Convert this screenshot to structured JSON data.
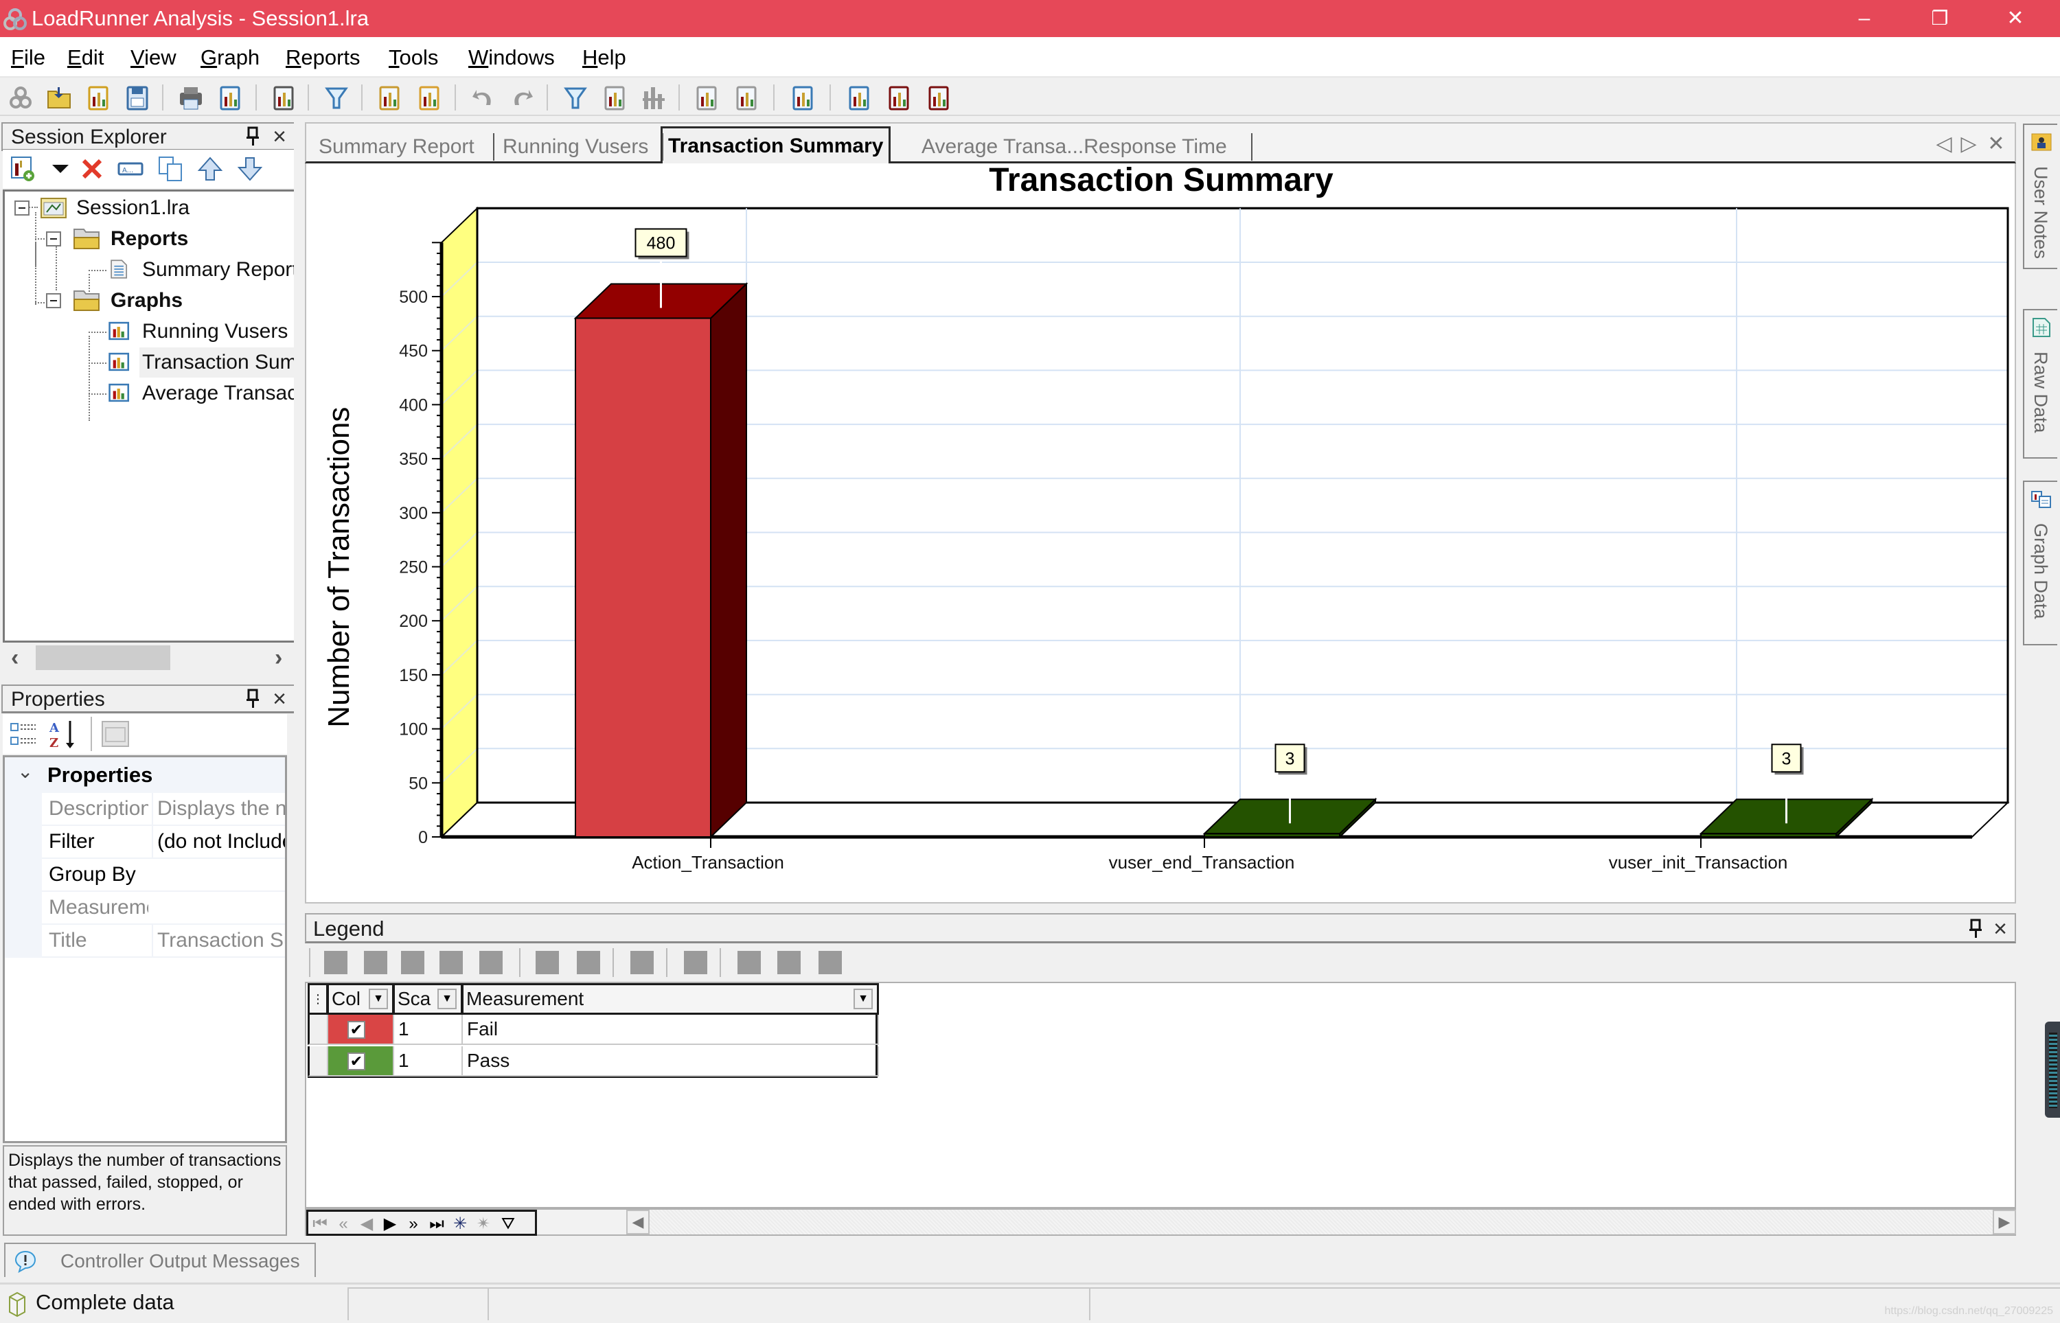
{
  "window": {
    "title": "LoadRunner Analysis - Session1.lra",
    "minimize": "–",
    "restore": "❐",
    "close": "✕"
  },
  "menu": [
    {
      "label": "File",
      "accel": "F"
    },
    {
      "label": "Edit",
      "accel": "E"
    },
    {
      "label": "View",
      "accel": "V"
    },
    {
      "label": "Graph",
      "accel": "G"
    },
    {
      "label": "Reports",
      "accel": "R"
    },
    {
      "label": "Tools",
      "accel": "T"
    },
    {
      "label": "Windows",
      "accel": "W"
    },
    {
      "label": "Help",
      "accel": "H"
    }
  ],
  "toolbar": {
    "icons": [
      "connect-icon",
      "open-session-icon",
      "new-session-icon",
      "save-icon",
      "print-icon",
      "export-icon",
      "add-graph-icon",
      "filter-icon",
      "cross-result-icon",
      "timezone-icon",
      "undo-icon",
      "redo-icon",
      "set-filter-icon",
      "clear-filter-icon",
      "group-by-icon",
      "merge-graphs-icon",
      "correlate-icon",
      "report-icon",
      "comments-icon",
      "auto-correlate-icon",
      "analyze-icon"
    ]
  },
  "session_explorer": {
    "title": "Session Explorer",
    "tree": [
      {
        "label": "Session1.lra",
        "level": 0,
        "bold": false
      },
      {
        "label": "Reports",
        "level": 1,
        "bold": true
      },
      {
        "label": "Summary Report",
        "level": 2,
        "bold": false
      },
      {
        "label": "Graphs",
        "level": 1,
        "bold": true
      },
      {
        "label": "Running Vusers",
        "level": 2,
        "bold": false
      },
      {
        "label": "Transaction Summary",
        "level": 2,
        "bold": false,
        "selected": true
      },
      {
        "label": "Average Transaction Response Time",
        "level": 2,
        "bold": false
      }
    ],
    "scroll_prev": "‹",
    "scroll_next": "›"
  },
  "properties": {
    "title": "Properties",
    "category": "Properties",
    "rows": [
      {
        "name": "Description",
        "value": "Displays the number of transactions that passed, failed, stopped, or ended with errors.",
        "muted": true
      },
      {
        "name": "Filter",
        "value": "(do not Include)",
        "muted": false
      },
      {
        "name": "Group By",
        "value": "",
        "muted": false
      },
      {
        "name": "Measurement",
        "value": "",
        "muted": true
      },
      {
        "name": "Title",
        "value": "Transaction Summary",
        "muted": true
      }
    ],
    "description": "Displays the number of transactions that passed, failed, stopped, or ended with errors."
  },
  "tabs": [
    {
      "label": "Summary Report",
      "active": false
    },
    {
      "label": "Running Vusers",
      "active": false
    },
    {
      "label": "Transaction Summary",
      "active": true
    },
    {
      "label": "Average Transa...Response Time",
      "active": false
    }
  ],
  "tab_nav": {
    "prev": "◁",
    "next": "▷",
    "close": "✕"
  },
  "side_tabs": [
    {
      "label": "User Notes"
    },
    {
      "label": "Raw Data"
    },
    {
      "label": "Graph Data"
    }
  ],
  "chart_data": {
    "type": "bar",
    "title": "Transaction Summary",
    "xlabel": "",
    "ylabel": "Number of Transactions",
    "categories": [
      "Action_Transaction",
      "vuser_end_Transaction",
      "vuser_init_Transaction"
    ],
    "series": [
      {
        "name": "Fail",
        "color": "#d64044",
        "values": [
          480,
          0,
          0
        ]
      },
      {
        "name": "Pass",
        "color": "#245200",
        "values": [
          0,
          3,
          3
        ]
      }
    ],
    "data_labels": [
      {
        "category": "Action_Transaction",
        "series": "Fail",
        "text": "480"
      },
      {
        "category": "vuser_end_Transaction",
        "series": "Pass",
        "text": "3"
      },
      {
        "category": "vuser_init_Transaction",
        "series": "Pass",
        "text": "3"
      }
    ],
    "ylim": [
      0,
      550
    ],
    "yticks": [
      0,
      50,
      100,
      150,
      200,
      250,
      300,
      350,
      400,
      450,
      500
    ],
    "grid": true,
    "style": "3d",
    "wall_color": "#ffff80"
  },
  "legend": {
    "title": "Legend",
    "columns": [
      {
        "label": "Col",
        "has_dropdown": true
      },
      {
        "label": "Sca",
        "has_dropdown": true
      },
      {
        "label": "Measurement",
        "has_dropdown": true
      }
    ],
    "rows": [
      {
        "color": "#d94545",
        "checked": true,
        "scale": "1",
        "measurement": "Fail"
      },
      {
        "color": "#5a9a3a",
        "checked": true,
        "scale": "1",
        "measurement": "Pass"
      }
    ],
    "check_glyph": "✔",
    "dropdown_glyph": "▼"
  },
  "record_nav": {
    "first": "⏮",
    "prev_page": "«",
    "prev": "◀",
    "next": "▶",
    "next_page": "»",
    "last": "⏭",
    "new": "✳",
    "delete": "✴",
    "filter": "⛛"
  },
  "output_tab": {
    "label": "Controller Output Messages"
  },
  "status": {
    "text": "Complete data"
  },
  "watermark": "https://blog.csdn.net/qq_27009225"
}
